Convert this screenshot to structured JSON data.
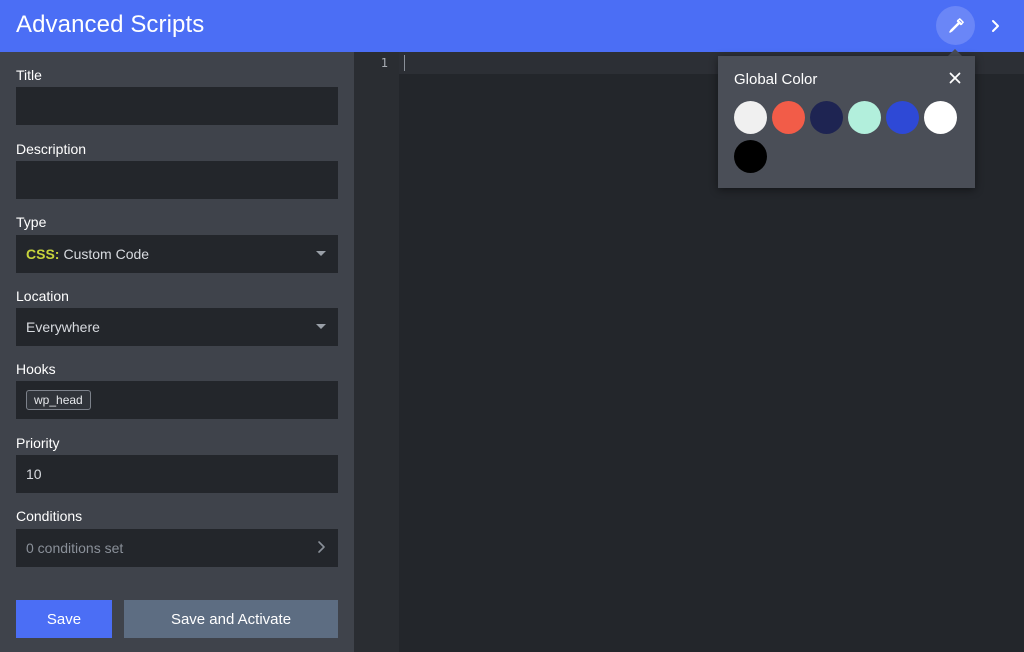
{
  "header": {
    "title": "Advanced Scripts",
    "picker_icon": "eyedropper-icon",
    "next_icon": "chevron-right-icon",
    "accent": "#4b6ef5"
  },
  "form": {
    "title": {
      "label": "Title",
      "value": ""
    },
    "description": {
      "label": "Description",
      "value": ""
    },
    "type": {
      "label": "Type",
      "prefix": "CSS:",
      "value": "Custom Code"
    },
    "location": {
      "label": "Location",
      "value": "Everywhere"
    },
    "hooks": {
      "label": "Hooks",
      "chip": "wp_head"
    },
    "priority": {
      "label": "Priority",
      "value": "10"
    },
    "conditions": {
      "label": "Conditions",
      "value": "0 conditions set"
    }
  },
  "buttons": {
    "save": "Save",
    "save_activate": "Save and Activate"
  },
  "editor": {
    "line_numbers": [
      "1"
    ]
  },
  "global_color": {
    "title": "Global Color",
    "close_icon": "close-icon",
    "swatches": [
      "#f0f0f0",
      "#f25c48",
      "#1e2452",
      "#b2efdc",
      "#2e49d6",
      "#ffffff",
      "#000000"
    ]
  }
}
